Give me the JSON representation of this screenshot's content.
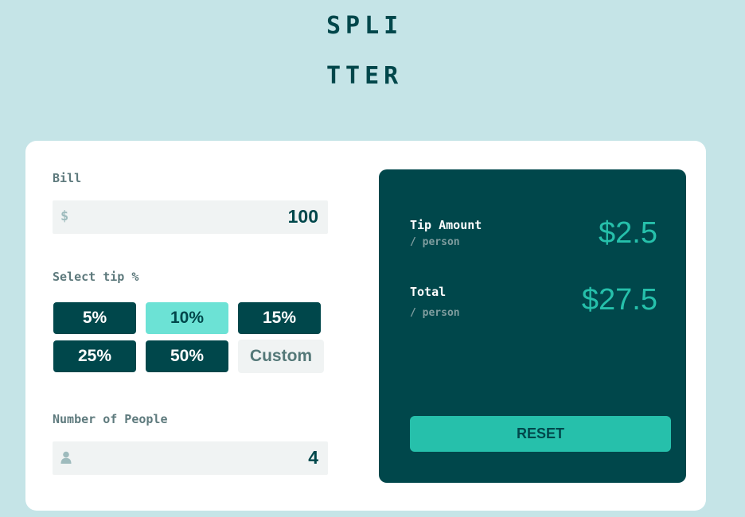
{
  "app": {
    "logo_line1": "SPLI",
    "logo_line2": "TTER"
  },
  "bill": {
    "label": "Bill",
    "prefix": "$",
    "value": "100"
  },
  "tip": {
    "label": "Select tip %",
    "options": [
      {
        "label": "5%",
        "selected": false
      },
      {
        "label": "10%",
        "selected": true
      },
      {
        "label": "15%",
        "selected": false
      },
      {
        "label": "25%",
        "selected": false
      },
      {
        "label": "50%",
        "selected": false
      }
    ],
    "custom_label": "Custom"
  },
  "people": {
    "label": "Number of People",
    "icon": "person-icon",
    "value": "4"
  },
  "results": {
    "tip_amount_label": "Tip Amount",
    "tip_amount_sub": "/ person",
    "tip_amount_value": "$2.5",
    "total_label": "Total",
    "total_sub": "/ person",
    "total_value": "$27.5",
    "reset_label": "RESET"
  },
  "colors": {
    "background": "#c5e4e7",
    "dark_cyan": "#00474b",
    "strong_cyan": "#26c0ab",
    "light_cyan": "#6ce2d5",
    "input_bg": "#f0f3f3"
  }
}
